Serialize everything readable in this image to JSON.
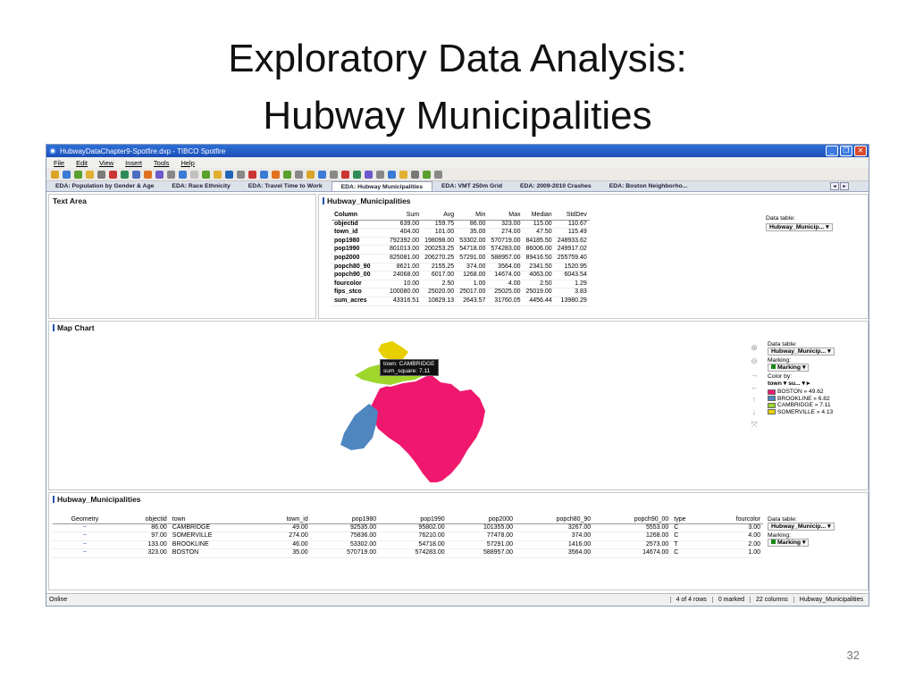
{
  "slide": {
    "title_line1": "Exploratory Data Analysis:",
    "title_line2": "Hubway Municipalities",
    "page_number": "32"
  },
  "window": {
    "title": "HubwayDataChapter9-Spotfire.dxp - TIBCO Spotfire",
    "menu": [
      "File",
      "Edit",
      "View",
      "Insert",
      "Tools",
      "Help"
    ],
    "toolbar_colors": [
      "#d9a428",
      "#3a7bd5",
      "#5aa02c",
      "#e0b030",
      "#7a7a7a",
      "#cc3333",
      "#2e8b57",
      "#4a6fc0",
      "#e07020",
      "#6a5acd",
      "#888888",
      "#3a7bd5",
      "#c0c0c0",
      "#5aa02c",
      "#e0b030",
      "#2266bb",
      "#888888",
      "#cc3333",
      "#3a7bd5",
      "#e07020",
      "#5aa02c",
      "#888888",
      "#d9a428",
      "#3a7bd5",
      "#888888",
      "#cc3333",
      "#2e8b57",
      "#6a5acd",
      "#888888",
      "#3a7bd5",
      "#e0b030",
      "#777777",
      "#5aa02c",
      "#888888"
    ]
  },
  "tabs": [
    "EDA: Population by Gender & Age",
    "EDA: Race Ethnicity",
    "EDA: Travel Time to Work",
    "EDA: Hubway Municipalities",
    "EDA: VMT 250m Grid",
    "EDA: 2009-2010 Crashes",
    "EDA: Boston Neighborho..."
  ],
  "active_tab": 3,
  "text_area": {
    "title": "Text Area"
  },
  "stats_panel": {
    "title": "Hubway_Municipalities",
    "columns": [
      "Column",
      "Sum",
      "Avg",
      "Min",
      "Max",
      "Median",
      "StdDev"
    ],
    "rows": [
      [
        "objectid",
        "639.00",
        "159.75",
        "86.00",
        "323.00",
        "115.00",
        "110.67"
      ],
      [
        "town_id",
        "404.00",
        "101.00",
        "35.00",
        "274.00",
        "47.50",
        "115.49"
      ],
      [
        "pop1980",
        "792392.00",
        "198098.00",
        "53302.00",
        "570719.00",
        "84185.50",
        "248933.62"
      ],
      [
        "pop1990",
        "801013.00",
        "200253.25",
        "54718.00",
        "574283.00",
        "86006.00",
        "249917.02"
      ],
      [
        "pop2000",
        "825081.00",
        "206270.25",
        "57291.00",
        "588957.00",
        "89416.50",
        "255759.40"
      ],
      [
        "popch80_90",
        "8621.00",
        "2155.25",
        "374.00",
        "3564.00",
        "2341.50",
        "1520.95"
      ],
      [
        "popch90_00",
        "24068.00",
        "6017.00",
        "1268.00",
        "14674.00",
        "4063.00",
        "6043.54"
      ],
      [
        "fourcolor",
        "10.00",
        "2.50",
        "1.00",
        "4.00",
        "2.50",
        "1.29"
      ],
      [
        "fips_stco",
        "100080.00",
        "25020.00",
        "25017.00",
        "25025.00",
        "25019.00",
        "3.83"
      ],
      [
        "sum_acres",
        "43316.51",
        "10829.13",
        "2643.57",
        "31760.05",
        "4456.44",
        "13980.29"
      ]
    ],
    "data_table_label": "Data table:",
    "data_table_value": "Hubway_Municip..."
  },
  "map_panel": {
    "title": "Map Chart",
    "tooltip_line1": "town: CAMBRIDGE",
    "tooltip_line2": "sum_square: 7.11",
    "data_table_label": "Data table:",
    "data_table_value": "Hubway_Municip...",
    "marking_label": "Marking:",
    "marking_value": "Marking",
    "color_by_label": "Color by:",
    "color_by_col": "town",
    "color_by_val": "su...",
    "legend": [
      {
        "label": "BOSTON » 49.62",
        "color": "#f0186e"
      },
      {
        "label": "BROOKLINE » 6.82",
        "color": "#4f86c0"
      },
      {
        "label": "CAMBRIDGE » 7.11",
        "color": "#9ed62c"
      },
      {
        "label": "SOMERVILLE » 4.13",
        "color": "#e8d000"
      }
    ]
  },
  "table_panel": {
    "title": "Hubway_Municipalities",
    "columns": [
      "Geometry",
      "objectid",
      "town",
      "town_id",
      "pop1980",
      "pop1990",
      "pop2000",
      "popch80_90",
      "popch90_00",
      "type",
      "fourcolor"
    ],
    "rows": [
      [
        "~",
        "86.00",
        "CAMBRIDGE",
        "49.00",
        "92535.00",
        "95802.00",
        "101355.00",
        "3267.00",
        "5553.00",
        "C",
        "3.00"
      ],
      [
        "~",
        "97.00",
        "SOMERVILLE",
        "274.00",
        "75836.00",
        "76210.00",
        "77478.00",
        "374.00",
        "1268.00",
        "C",
        "4.00"
      ],
      [
        "~",
        "133.00",
        "BROOKLINE",
        "46.00",
        "53302.00",
        "54718.00",
        "57291.00",
        "1416.00",
        "2573.00",
        "T",
        "2.00"
      ],
      [
        "~",
        "323.00",
        "BOSTON",
        "35.00",
        "570719.00",
        "574283.00",
        "588957.00",
        "3564.00",
        "14674.00",
        "C",
        "1.00"
      ]
    ],
    "data_table_label": "Data table:",
    "data_table_value": "Hubway_Municip...",
    "marking_label": "Marking:",
    "marking_value": "Marking"
  },
  "status": {
    "left": "Online",
    "rows": "4 of 4 rows",
    "marked": "0 marked",
    "columns": "22 columns",
    "table": "Hubway_Municipalities"
  }
}
